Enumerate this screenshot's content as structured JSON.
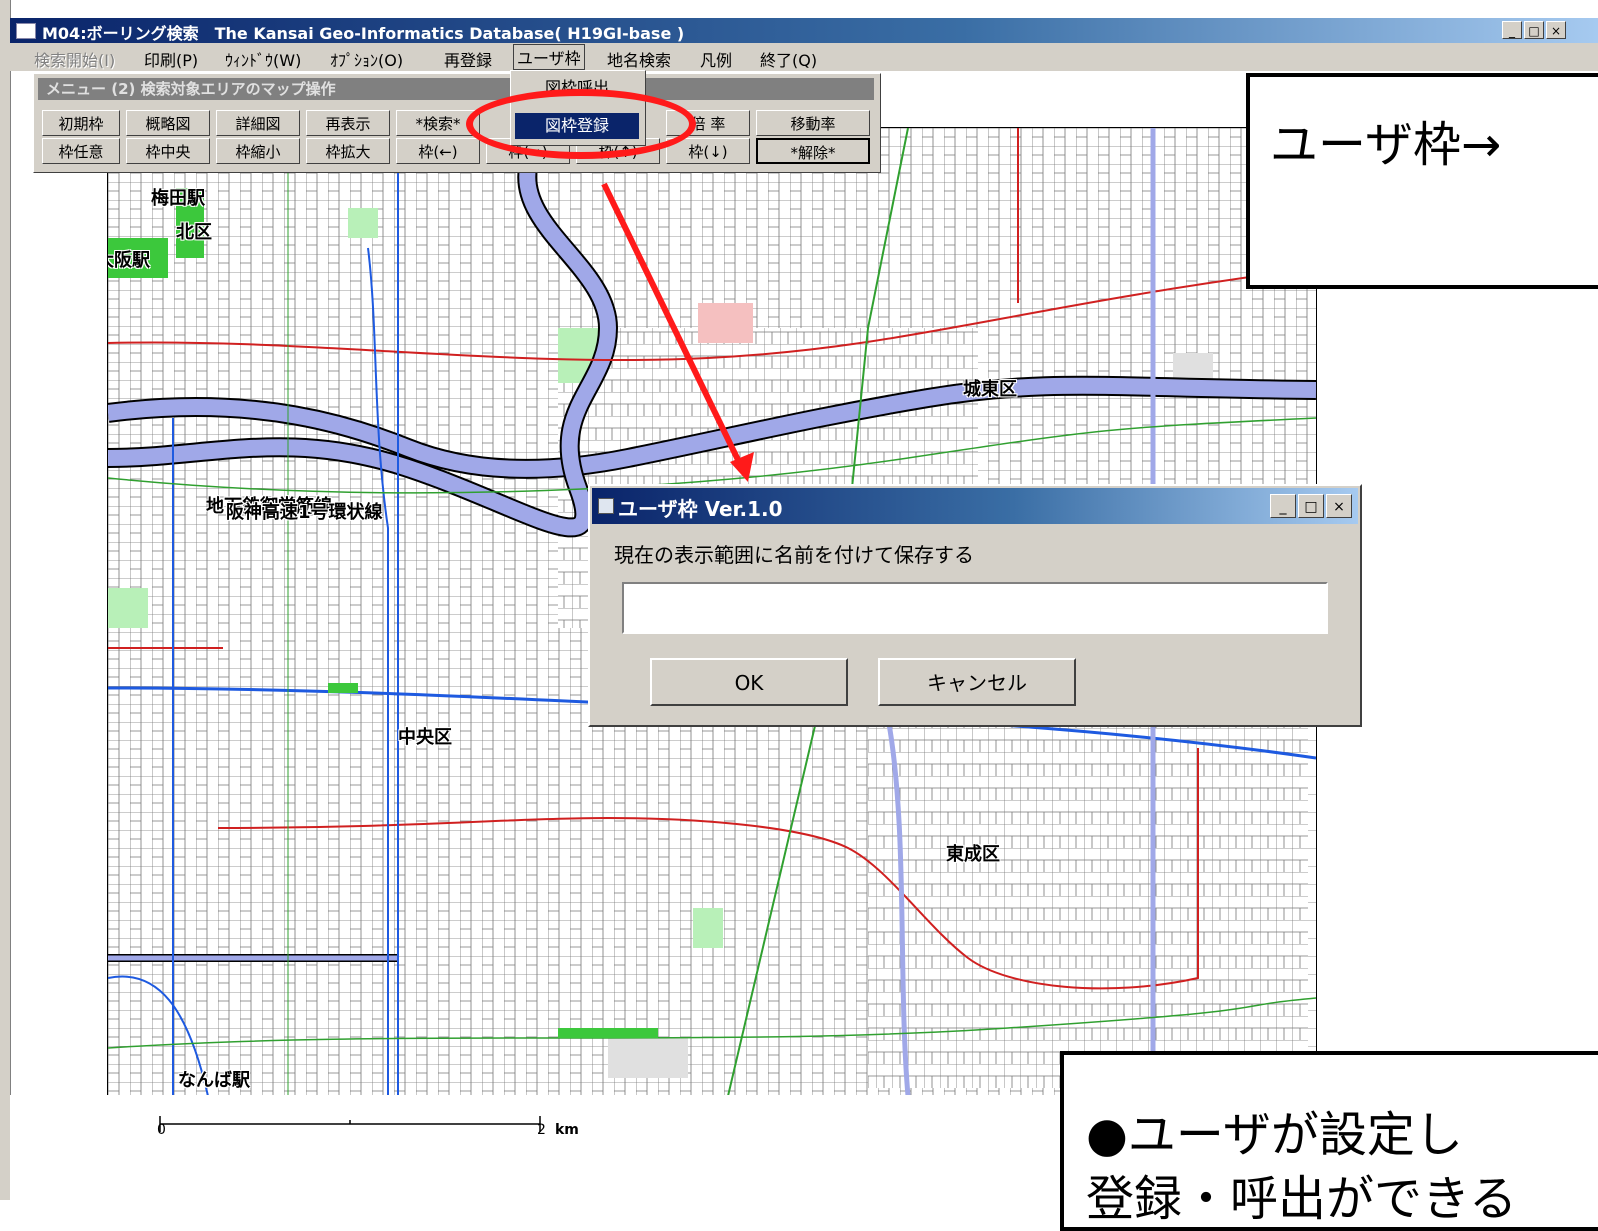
{
  "window": {
    "title": "M04:ボーリング検索　The Kansai Geo-Informatics Database( H19GI-base )",
    "minimize": "_",
    "maximize": "□",
    "close": "×"
  },
  "menubar": {
    "items": [
      {
        "label": "検索開始(I)",
        "disabled": true
      },
      {
        "label": "印刷(P)"
      },
      {
        "label": "ｳｨﾝﾄﾞｳ(W)"
      },
      {
        "label": "ｵﾌﾟｼｮﾝ(O)"
      },
      {
        "label": "再登録"
      },
      {
        "label": "ユーザ枠",
        "active": true
      },
      {
        "label": "地名検索"
      },
      {
        "label": "凡例"
      },
      {
        "label": "終了(Q)"
      }
    ]
  },
  "dropdown": {
    "items": [
      "図枠呼出",
      "図枠登録"
    ],
    "highlighted": "図枠登録"
  },
  "toolbox": {
    "title": "メニュー (2) 検索対象エリアのマップ操作",
    "row1": [
      "初期枠",
      "概略図",
      "詳細図",
      "再表示",
      "*検索*",
      "",
      "",
      "倍 率",
      "移動率"
    ],
    "row2": [
      "枠任意",
      "枠中央",
      "枠縮小",
      "枠拡大",
      "枠(←)",
      "枠(→)",
      "枠(↑)",
      "枠(↓)",
      "*解除*"
    ]
  },
  "map": {
    "labels": [
      "梅田駅",
      "北区",
      "大阪駅",
      "城東区",
      "地下鉄御堂筋線",
      "阪神高速1号環状線",
      "中央区",
      "東成区",
      "なんば駅"
    ],
    "scale": {
      "start": "0",
      "end": "2",
      "unit": "km"
    }
  },
  "dialog": {
    "title": "ユーザ枠 Ver.1.0",
    "label": "現在の表示範囲に名前を付けて保存する",
    "input_value": "",
    "ok": "OK",
    "cancel": "キャンセル"
  },
  "callouts": {
    "top": "ユーザ枠→",
    "bottom_line1": "●ユーザが設定し",
    "bottom_line2": "登録・呼出ができる"
  },
  "colors": {
    "highlight_red": "#ff1a1a",
    "titlebar": "#0a246a",
    "face": "#d4d0c8"
  }
}
